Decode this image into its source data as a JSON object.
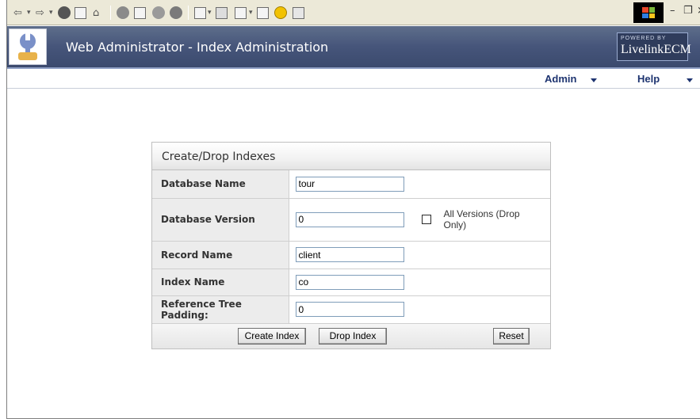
{
  "app": {
    "title": "Web Administrator - Index Administration",
    "brand_small": "POWERED BY",
    "brand_main": "LivelinkECM"
  },
  "nav": {
    "admin": "Admin",
    "help": "Help"
  },
  "panel": {
    "title": "Create/Drop Indexes",
    "fields": {
      "database_name": {
        "label": "Database Name",
        "value": "tour"
      },
      "database_version": {
        "label": "Database Version",
        "value": "0",
        "checkbox_label": "All Versions (Drop Only)",
        "checked": false
      },
      "record_name": {
        "label": "Record Name",
        "value": "client"
      },
      "index_name": {
        "label": "Index Name",
        "value": "co"
      },
      "ref_tree_padding": {
        "label": "Reference Tree Padding:",
        "value": "0"
      }
    },
    "buttons": {
      "create": "Create Index",
      "drop": "Drop Index",
      "reset": "Reset"
    }
  },
  "colors": {
    "header_bg": "#46557a",
    "nav_text": "#1e3470",
    "label_bg": "#ececec"
  }
}
